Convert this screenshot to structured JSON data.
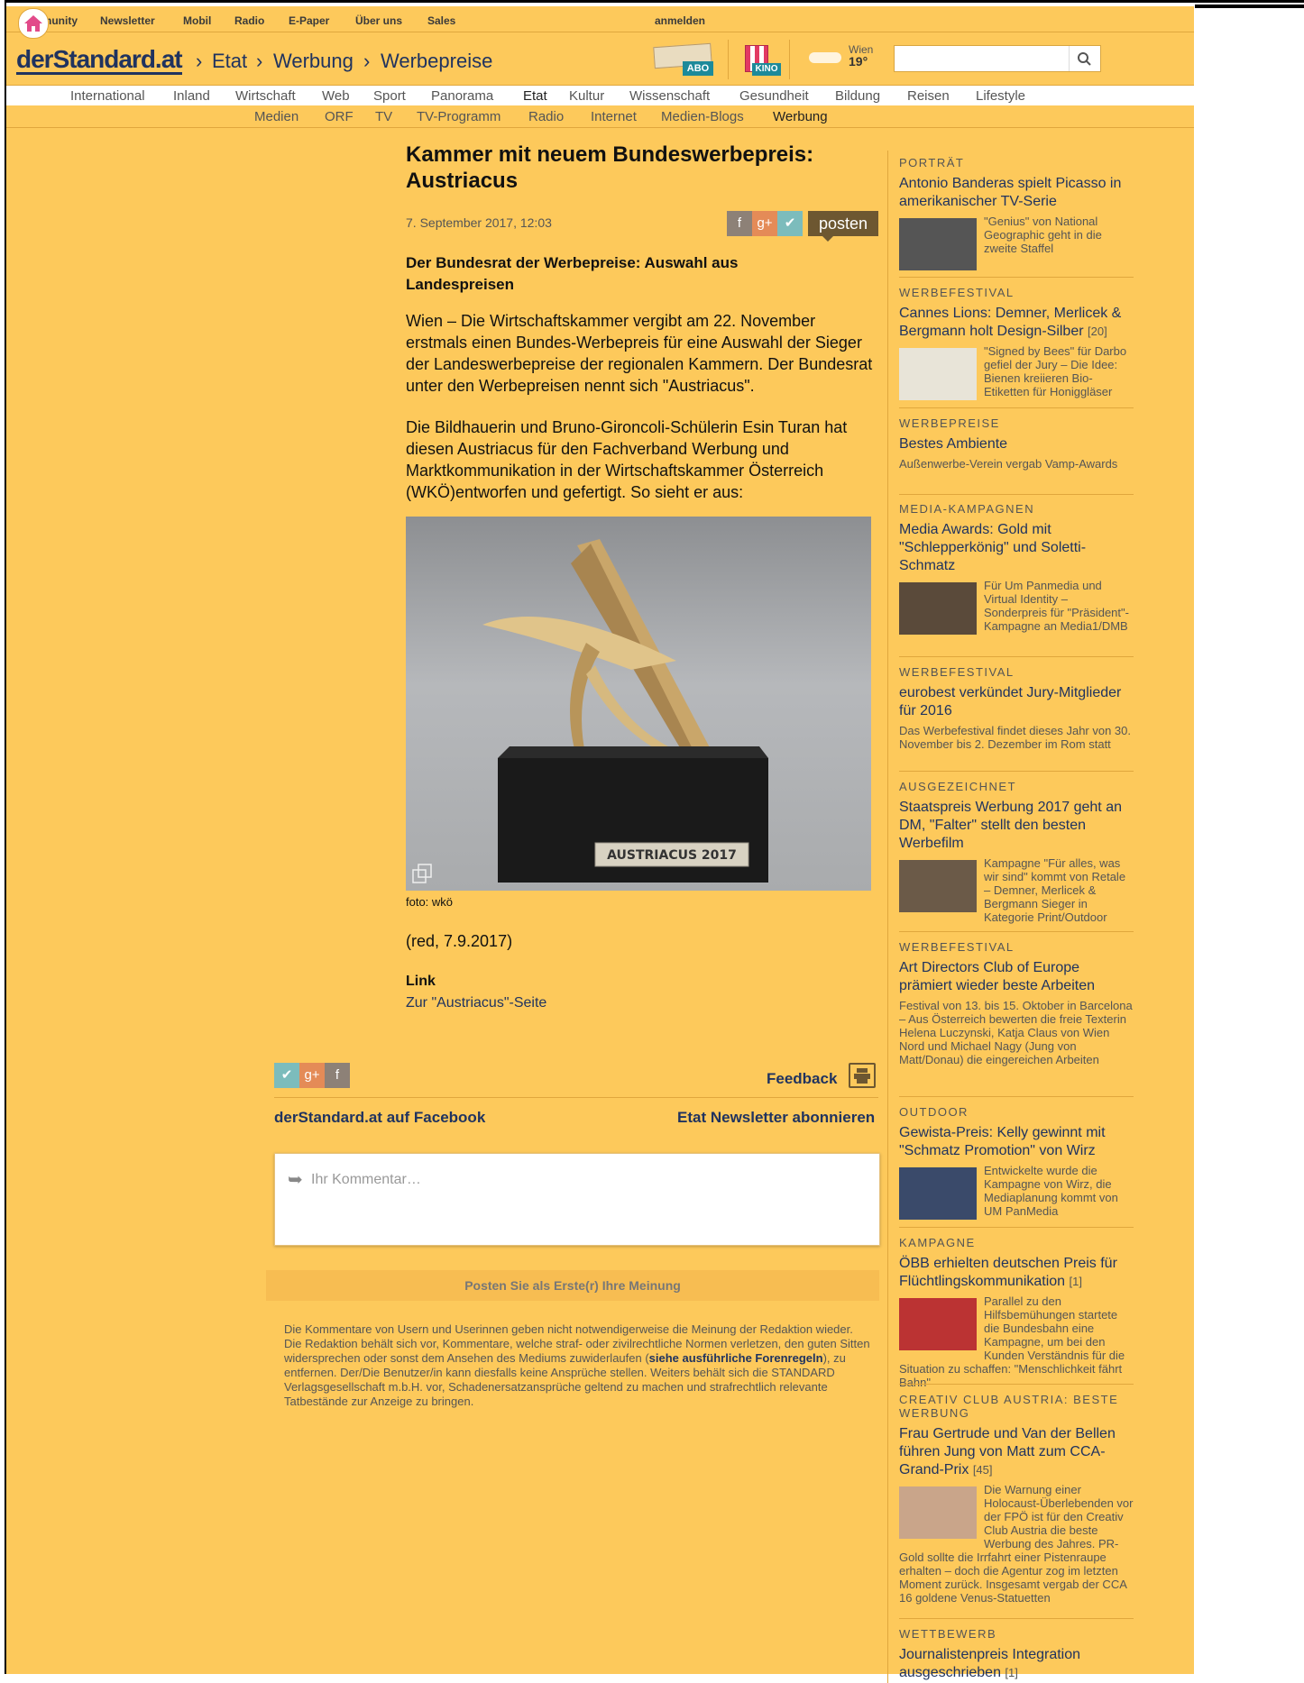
{
  "service_nav": [
    "Community",
    "Newsletter",
    "Mobil",
    "Radio",
    "E-Paper",
    "Über uns",
    "Sales"
  ],
  "login": "anmelden",
  "logo": "derStandard.at",
  "breadcrumb": [
    "Etat",
    "Werbung",
    "Werbepreise"
  ],
  "weather": {
    "city": "Wien",
    "temp": "19°"
  },
  "promo": {
    "abo": "ABO",
    "kino": "KINO"
  },
  "sections": [
    "International",
    "Inland",
    "Wirtschaft",
    "Web",
    "Sport",
    "Panorama",
    "Etat",
    "Kultur",
    "Wissenschaft",
    "Gesundheit",
    "Bildung",
    "Reisen",
    "Lifestyle"
  ],
  "subsections": [
    "Medien",
    "ORF",
    "TV",
    "TV-Programm",
    "Radio",
    "Internet",
    "Medien-Blogs",
    "Werbung"
  ],
  "article": {
    "title": "Kammer mit neuem Bundeswerbepreis: Austriacus",
    "date": "7. September 2017, 12:03",
    "posten": "posten",
    "lead": "Der Bundesrat der Werbepreise: Auswahl aus Landespreisen",
    "p1": "Wien – Die Wirtschaftskammer vergibt am 22. November erstmals einen Bundes-Werbepreis für eine Auswahl der Sieger der Landeswerbepreise der regionalen Kammern. Der Bundesrat unter den Werbepreisen nennt sich \"Austriacus\".",
    "p2": "Die Bildhauerin und Bruno-Gironcoli-Schülerin Esin Turan hat diesen Austriacus für den Fachverband Werbung und Marktkommunikation in der Wirtschaftskammer Österreich (WKÖ)entworfen und gefertigt. So sieht er aus:",
    "plaque": "AUSTRIACUS 2017",
    "caption": "foto: wkö",
    "signoff": "(red, 7.9.2017)",
    "link_heading": "Link",
    "link_text": "Zur \"Austriacus\"-Seite"
  },
  "footer": {
    "feedback": "Feedback",
    "facebook": "derStandard.at auf Facebook",
    "newsletter": "Etat Newsletter abonnieren",
    "comment_placeholder": "Ihr Kommentar…",
    "first_post": "Posten Sie als Erste(r) Ihre Meinung",
    "disclaimer_a": "Die Kommentare von Usern und Userinnen geben nicht notwendigerweise die Meinung der Redaktion wieder. Die Redaktion behält sich vor, Kommentare, welche straf- oder zivilrechtliche Normen verletzen, den guten Sitten widersprechen oder sonst dem Ansehen des Mediums zuwiderlaufen (",
    "disclaimer_link": "siehe ausführliche Forenregeln",
    "disclaimer_b": "), zu entfernen. Der/Die Benutzer/in kann diesfalls keine Ansprüche stellen. Weiters behält sich die STANDARD Verlagsgesellschaft m.b.H. vor, Schadenersatzansprüche geltend zu machen und strafrechtlich relevante Tatbestände zur Anzeige zu bringen."
  },
  "sidebar": [
    {
      "cat": "PORTRÄT",
      "title": "Antonio Banderas spielt Picasso in amerikanischer TV-Serie",
      "count": "",
      "teaser": "\"Genius\" von National Geographic geht in die zweite Staffel",
      "thumb": true
    },
    {
      "cat": "WERBEFESTIVAL",
      "title": "Cannes Lions: Demner, Merlicek & Bergmann holt Design-Silber",
      "count": "[20]",
      "teaser": "\"Signed by Bees\" für Darbo gefiel der Jury – Die Idee: Bienen kreiieren Bio-Etiketten für Honiggläser",
      "thumb": true
    },
    {
      "cat": "WERBEPREISE",
      "title": "Bestes Ambiente",
      "count": "",
      "teaser": "Außenwerbe-Verein vergab Vamp-Awards",
      "thumb": false
    },
    {
      "cat": "MEDIA-KAMPAGNEN",
      "title": "Media Awards: Gold mit \"Schlepperkönig\" und Soletti-Schmatz",
      "count": "",
      "teaser": "Für Um Panmedia und Virtual Identity – Sonderpreis für \"Präsident\"-Kampagne an Media1/DMB",
      "thumb": true
    },
    {
      "cat": "WERBEFESTIVAL",
      "title": "eurobest verkündet Jury-Mitglieder für 2016",
      "count": "",
      "teaser": "Das Werbefestival findet dieses Jahr von 30. November bis 2. Dezember im Rom statt",
      "thumb": false
    },
    {
      "cat": "AUSGEZEICHNET",
      "title": "Staatspreis Werbung 2017 geht an DM, \"Falter\" stellt den besten Werbefilm",
      "count": "",
      "teaser": "Kampagne \"Für alles, was wir sind\" kommt von Retale – Demner, Merlicek & Bergmann Sieger in Kategorie Print/Outdoor",
      "thumb": true
    },
    {
      "cat": "WERBEFESTIVAL",
      "title": "Art Directors Club of Europe prämiert wieder beste Arbeiten",
      "count": "",
      "teaser": "Festival von 13. bis 15. Oktober in Barcelona – Aus Österreich bewerten die freie Texterin Helena Luczynski, Katja Claus von Wien Nord und Michael Nagy (Jung von Matt/Donau) die eingereichen Arbeiten",
      "thumb": false
    },
    {
      "cat": "OUTDOOR",
      "title": "Gewista-Preis: Kelly gewinnt mit \"Schmatz Promotion\" von Wirz",
      "count": "",
      "teaser": "Entwickelte wurde die Kampagne von Wirz, die Mediaplanung kommt von UM PanMedia",
      "thumb": true
    },
    {
      "cat": "KAMPAGNE",
      "title": "ÖBB erhielten deutschen Preis für Flüchtlingskommunikation",
      "count": "[1]",
      "teaser": "Parallel zu den Hilfsbemühungen startete die Bundesbahn eine Kampagne, um bei den Kunden Verständnis für die Situation zu schaffen: \"Menschlichkeit fährt Bahn\"",
      "thumb": true
    },
    {
      "cat": "CREATIV CLUB AUSTRIA: BESTE WERBUNG",
      "title": "Frau Gertrude und Van der Bellen führen Jung von Matt zum CCA-Grand-Prix",
      "count": "[45]",
      "teaser": "Die Warnung einer Holocaust-Überlebenden vor der FPÖ ist für den Creativ Club Austria die beste Werbung des Jahres. PR-Gold sollte die Irrfahrt einer Pistenraupe erhalten – doch die Agentur zog im letzten Moment zurück. Insgesamt vergab der CCA 16 goldene Venus-Statuetten",
      "thumb": true
    },
    {
      "cat": "WETTBEWERB",
      "title": "Journalistenpreis Integration ausgeschrieben",
      "count": "[1]",
      "teaser": "",
      "thumb": false
    }
  ],
  "colors": {
    "bg": "#fdc95b",
    "link": "#20335f",
    "posten": "#6d5731"
  }
}
